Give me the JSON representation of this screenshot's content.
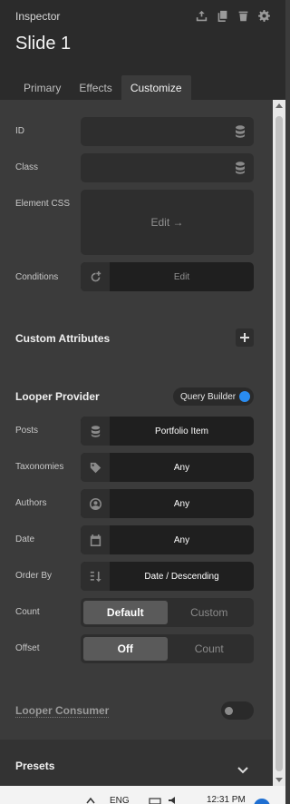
{
  "header": {
    "app_title": "Inspector",
    "doc_title": "Slide 1",
    "icons": [
      "move-up-icon",
      "copy-icon",
      "trash-icon",
      "gear-icon"
    ]
  },
  "tabs": [
    {
      "label": "Primary",
      "active": false
    },
    {
      "label": "Effects",
      "active": false
    },
    {
      "label": "Customize",
      "active": true
    }
  ],
  "fields": {
    "id": {
      "label": "ID",
      "value": ""
    },
    "class": {
      "label": "Class",
      "value": ""
    },
    "element_css": {
      "label": "Element CSS",
      "action": "Edit →"
    },
    "conditions": {
      "label": "Conditions",
      "action": "Edit"
    }
  },
  "custom_attributes": {
    "title": "Custom Attributes"
  },
  "looper_provider": {
    "title": "Looper Provider",
    "query_builder": {
      "label": "Query Builder",
      "enabled": true
    },
    "posts": {
      "label": "Posts",
      "value": "Portfolio Item"
    },
    "taxonomies": {
      "label": "Taxonomies",
      "value": "Any"
    },
    "authors": {
      "label": "Authors",
      "value": "Any"
    },
    "date": {
      "label": "Date",
      "value": "Any"
    },
    "order_by": {
      "label": "Order By",
      "value": "Date / Descending"
    },
    "count": {
      "label": "Count",
      "options": [
        "Default",
        "Custom"
      ],
      "selected": "Default"
    },
    "offset": {
      "label": "Offset",
      "options": [
        "Off",
        "Count"
      ],
      "selected": "Off"
    }
  },
  "looper_consumer": {
    "title": "Looper Consumer",
    "enabled": false
  },
  "presets": {
    "title": "Presets"
  },
  "taskbar": {
    "lang": "ENG",
    "time": "12:31 PM"
  },
  "colors": {
    "accent": "#2a8cf0",
    "panel": "#3b3b3b",
    "header": "#2b2b2b"
  }
}
